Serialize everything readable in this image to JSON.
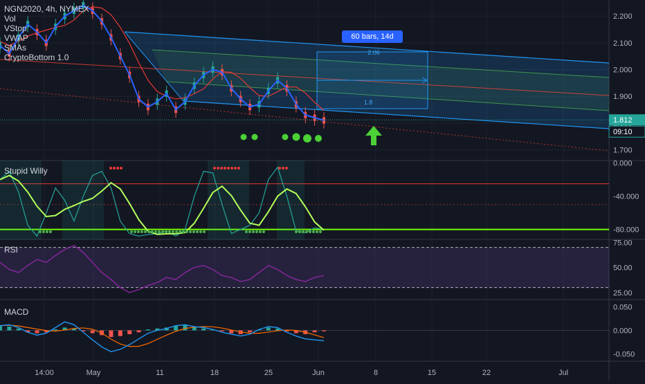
{
  "header": {
    "symbol_line": "NGN2020, 4h, NYMEX",
    "indicators": [
      "Vol",
      "VStop",
      "VWAP",
      "SMAs",
      "CryptoBottom 1.0"
    ]
  },
  "panes": {
    "willy_label": "Stupid Willy",
    "rsi_label": "RSI",
    "macd_label": "MACD"
  },
  "measure": {
    "label": "60 bars, 14d",
    "upper": "2.06",
    "lower": "1.8"
  },
  "price_tag": {
    "price": "1.812",
    "countdown": "09:10"
  },
  "colors": {
    "background": "#131722",
    "price_line": "#2962ff",
    "channel": "#2196f3",
    "signal_dots": "#4cd137",
    "up_arrow": "#4cd137",
    "rsi_band": "#7e57c2"
  },
  "chart_data": [
    {
      "type": "line",
      "title": "NGN2020, 4h, NYMEX",
      "x_ticks": [
        "14:00",
        "May",
        "11",
        "18",
        "25",
        "Jun",
        "8",
        "15",
        "22",
        "Jul"
      ],
      "y_ticks": [
        "2.200",
        "2.100",
        "2.000",
        "1.900",
        "1.800",
        "1.700"
      ],
      "ylim": [
        1.66,
        2.26
      ],
      "series": [
        {
          "values": [
            2.09,
            2.06,
            2.12,
            2.17,
            2.14,
            2.1,
            2.16,
            2.2,
            2.22,
            2.24,
            2.22,
            2.18,
            2.12,
            2.05,
            1.98,
            1.89,
            1.86,
            1.88,
            1.91,
            1.85,
            1.88,
            1.94,
            1.98,
            2.0,
            1.99,
            1.93,
            1.89,
            1.86,
            1.87,
            1.92,
            1.96,
            1.93,
            1.87,
            1.83,
            1.82,
            1.81
          ]
        }
      ],
      "last_price": 1.812
    },
    {
      "type": "line",
      "title": "Stupid Willy",
      "y_ticks": [
        "0.000",
        "-40.000",
        "-80.000"
      ],
      "ylim": [
        -92,
        3
      ],
      "levels": [
        -25,
        -80
      ]
    },
    {
      "type": "line",
      "title": "RSI",
      "y_ticks": [
        "75.00",
        "50.00",
        "25.00"
      ],
      "ylim": [
        18,
        78
      ],
      "levels": [
        70,
        30
      ],
      "series": [
        {
          "values": [
            55,
            48,
            45,
            52,
            58,
            55,
            62,
            68,
            72,
            65,
            55,
            45,
            38,
            30,
            25,
            28,
            32,
            35,
            40,
            38,
            45,
            50,
            52,
            48,
            42,
            40,
            36,
            38,
            45,
            52,
            48,
            42,
            38,
            36,
            40,
            42
          ]
        }
      ]
    },
    {
      "type": "bar",
      "title": "MACD",
      "y_ticks": [
        "0.050",
        "0.000",
        "-0.050"
      ],
      "ylim": [
        -0.065,
        0.065
      ]
    }
  ]
}
